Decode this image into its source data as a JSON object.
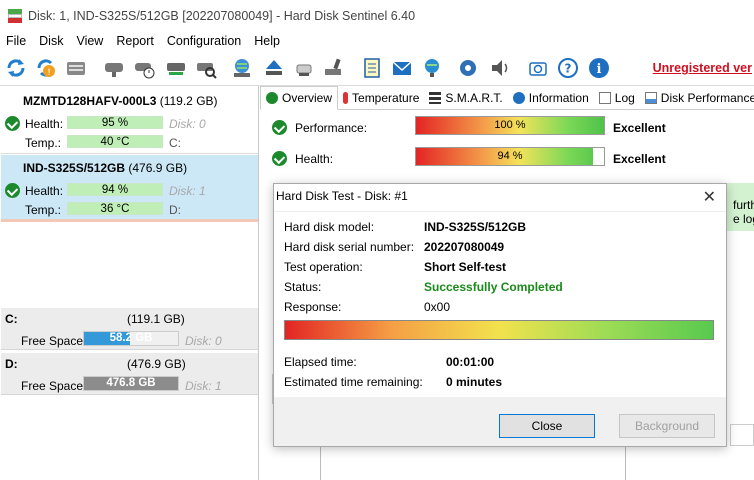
{
  "window": {
    "title": "Disk: 1, IND-S325S/512GB [202207080049]  -  Hard Disk Sentinel 6.40"
  },
  "menu": [
    "File",
    "Disk",
    "View",
    "Report",
    "Configuration",
    "Help"
  ],
  "toolbar": {
    "icons": [
      "refresh-icon",
      "refresh-warning-icon",
      "drive-icon",
      "disk-surface-icon",
      "disk-test-icon",
      "disk-test-run-icon",
      "disk-search-icon",
      "globe-drive-icon",
      "eject-icon",
      "usb-drive-icon",
      "drive-pencil-icon",
      "report-icon",
      "mail-icon",
      "network-icon",
      "settings-gear-icon",
      "sound-icon",
      "camera-icon",
      "help-icon",
      "info-icon"
    ],
    "unregistered_label": "Unregistered ver"
  },
  "disks": [
    {
      "name": "MZMTD128HAFV-000L3",
      "size": "(119.2 GB)",
      "health_label": "Health:",
      "health": "95 %",
      "temp_label": "Temp.:",
      "temp": "40 °C",
      "disk_ref": "Disk: 0",
      "drive_letter": "C:"
    },
    {
      "name": "IND-S325S/512GB",
      "size": "(476.9 GB)",
      "health_label": "Health:",
      "health": "94 %",
      "temp_label": "Temp.:",
      "temp": "36 °C",
      "disk_ref": "Disk: 1",
      "drive_letter": "D:"
    }
  ],
  "partitions": [
    {
      "letter": "C:",
      "size": "(119.1 GB)",
      "free_label": "Free Space",
      "free": "58.2 GB",
      "free_fraction": 0.49,
      "disk_ref": "Disk: 0"
    },
    {
      "letter": "D:",
      "size": "(476.9 GB)",
      "free_label": "Free Space",
      "free": "476.8 GB",
      "free_fraction": 1.0,
      "disk_ref": "Disk: 1"
    }
  ],
  "tabs": [
    "Overview",
    "Temperature",
    "S.M.A.R.T.",
    "Information",
    "Log",
    "Disk Performance"
  ],
  "overview": {
    "performance_label": "Performance:",
    "performance_value": "100 %",
    "performance_fraction": 1.0,
    "performance_rating": "Excellent",
    "health_label": "Health:",
    "health_value": "94 %",
    "health_fraction": 0.94,
    "health_rating": "Excellent",
    "partial_text_1": "furthe",
    "partial_text_2": "e logg"
  },
  "dialog": {
    "title": "Hard Disk Test - Disk: #1",
    "fields": [
      {
        "label": "Hard disk model:",
        "value": "IND-S325S/512GB"
      },
      {
        "label": "Hard disk serial number:",
        "value": "202207080049"
      },
      {
        "label": "Test operation:",
        "value": "Short Self-test"
      },
      {
        "label": "Status:",
        "value": "Successfully Completed"
      },
      {
        "label": "Response:",
        "value": "0x00"
      }
    ],
    "progress_fraction": 1.0,
    "elapsed_label": "Elapsed time:",
    "elapsed_value": "00:01:00",
    "remaining_label": "Estimated time remaining:",
    "remaining_value": "0 minutes",
    "close_label": "Close",
    "background_label": "Background"
  },
  "colors": {
    "selected_disk_bg": "#cce8f7",
    "health_bar": "#bfeeb7",
    "status_green": "#1a8a1a",
    "unregistered_red": "#d01020",
    "free_space_c": "#3399d9",
    "free_space_d": "#8c8c8c"
  }
}
